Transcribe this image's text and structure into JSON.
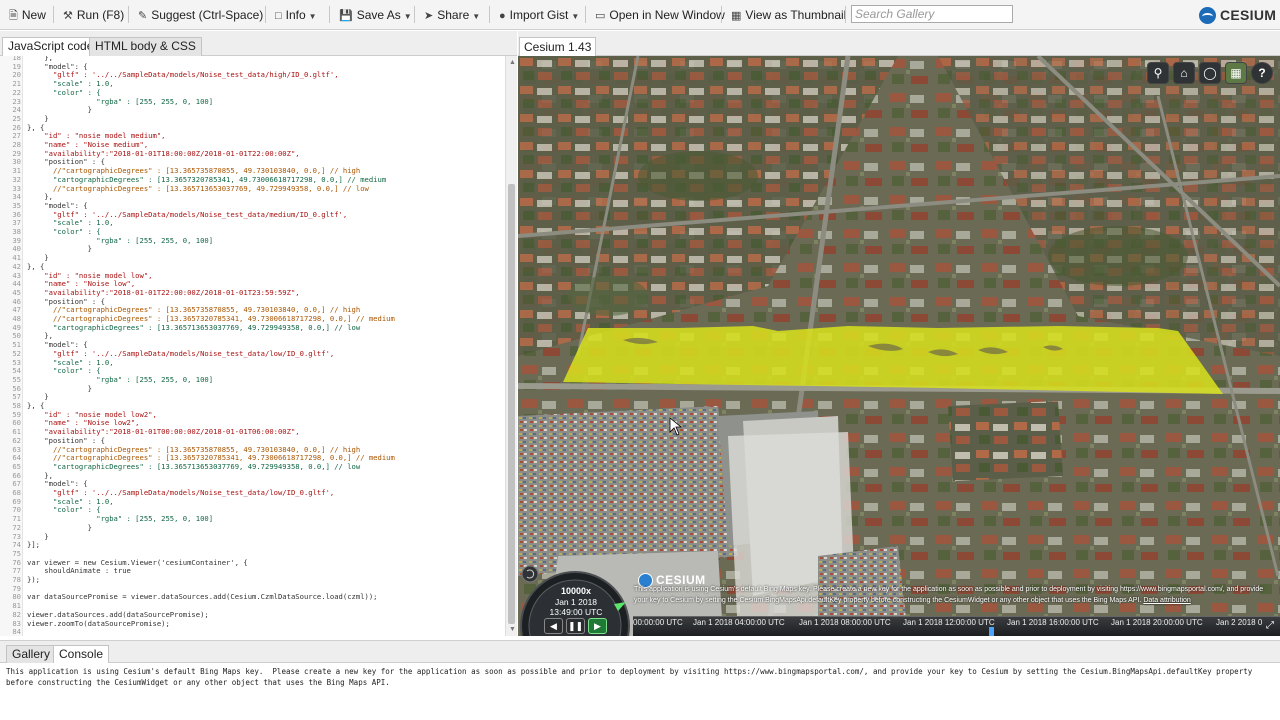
{
  "toolbar": {
    "new_label": "New",
    "run_label": "Run (F8)",
    "suggest_label": "Suggest (Ctrl-Space)",
    "info_label": "Info",
    "save_as_label": "Save As",
    "share_label": "Share",
    "import_gist_label": "Import Gist",
    "open_window_label": "Open in New Window",
    "thumbnail_label": "View as Thumbnail",
    "search_placeholder": "Search Gallery",
    "brand": "CESIUM"
  },
  "editor": {
    "tabs": [
      "JavaScript code",
      "HTML body & CSS"
    ],
    "active_tab": "JavaScript code",
    "first_line_number": 18,
    "lines": [
      "    },",
      "    \"model\": {",
      "      \"gltf\" : '../../SampleData/models/Noise_test_data/high/ID_0.gltf',",
      "      \"scale\" : 1.0,",
      "      \"color\" : {",
      "                \"rgba\" : [255, 255, 0, 100]",
      "              }",
      "    }",
      "}, {",
      "    \"id\" : \"nosie model medium\",",
      "    \"name\" : \"Noise medium\",",
      "    \"availability\":\"2018-01-01T18:00:00Z/2018-01-01T22:00:00Z\",",
      "    \"position\" : {",
      "      //\"cartographicDegrees\" : [13.365735870855, 49.730103840, 0.0,] // high",
      "      \"cartographicDegrees\" : [13.3657320785341, 49.73006618717298, 0.0,] // medium",
      "      //\"cartographicDegrees\" : [13.365713653037769, 49.729949358, 0.0,] // low",
      "    },",
      "    \"model\": {",
      "      \"gltf\" : '../../SampleData/models/Noise_test_data/medium/ID_0.gltf',",
      "      \"scale\" : 1.0,",
      "      \"color\" : {",
      "                \"rgba\" : [255, 255, 0, 100]",
      "              }",
      "    }",
      "}, {",
      "    \"id\" : \"nosie model low\",",
      "    \"name\" : \"Noise low\",",
      "    \"availability\":\"2018-01-01T22:00:00Z/2018-01-01T23:59:59Z\",",
      "    \"position\" : {",
      "      //\"cartographicDegrees\" : [13.365735870855, 49.730103840, 0.0,] // high",
      "      //\"cartographicDegrees\" : [13.3657320785341, 49.73006618717298, 0.0,] // medium",
      "      \"cartographicDegrees\" : [13.365713653037769, 49.729949358, 0.0,] // low",
      "    },",
      "    \"model\": {",
      "      \"gltf\" : '../../SampleData/models/Noise_test_data/low/ID_0.gltf',",
      "      \"scale\" : 1.0,",
      "      \"color\" : {",
      "                \"rgba\" : [255, 255, 0, 100]",
      "              }",
      "    }",
      "}, {",
      "    \"id\" : \"nosie model low2\",",
      "    \"name\" : \"Noise low2\",",
      "    \"availability\":\"2018-01-01T00:00:00Z/2018-01-01T06:00:00Z\",",
      "    \"position\" : {",
      "      //\"cartographicDegrees\" : [13.365735870855, 49.730103840, 0.0,] // high",
      "      //\"cartographicDegrees\" : [13.3657320785341, 49.73006618717298, 0.0,] // medium",
      "      \"cartographicDegrees\" : [13.365713653037769, 49.729949358, 0.0,] // low",
      "    },",
      "    \"model\": {",
      "      \"gltf\" : '../../SampleData/models/Noise_test_data/low/ID_0.gltf',",
      "      \"scale\" : 1.0,",
      "      \"color\" : {",
      "                \"rgba\" : [255, 255, 0, 100]",
      "              }",
      "    }",
      "}];",
      "",
      "var viewer = new Cesium.Viewer('cesiumContainer', {",
      "    shouldAnimate : true",
      "});",
      "",
      "var dataSourcePromise = viewer.dataSources.add(Cesium.CzmlDataSource.load(czml));",
      "",
      "viewer.dataSources.add(dataSourcePromise);",
      "viewer.zoomTo(dataSourcePromise);",
      ""
    ]
  },
  "viewer": {
    "tab_label": "Cesium 1.43",
    "nav_buttons": [
      "search-icon",
      "home-icon",
      "globe-icon",
      "imagery-layer-icon",
      "help-icon"
    ],
    "credit_logo": "CESIUM",
    "credit_text": "This application is using Cesium's default Bing Maps key. Please create a new key for the application as soon as possible and prior to deployment by visiting https://www.bingmapsportal.com/, and provide your key to Cesium by setting the Cesium.BingMapsApi.defaultKey property before constructing the CesiumWidget or any other object that uses the Bing Maps API.",
    "credit_link": "Data attribution",
    "overlay_color": "#d8e21c",
    "animation": {
      "speed": "10000x",
      "date": "Jan 1 2018",
      "time": "13:49:00 UTC",
      "reverse_icon": "play-reverse-icon",
      "pause_icon": "pause-icon",
      "play_icon": "play-icon"
    },
    "timeline_ticks": [
      "00:00:00 UTC",
      "Jan 1 2018 04:00:00 UTC",
      "Jan 1 2018 08:00:00 UTC",
      "Jan 1 2018 12:00:00 UTC",
      "Jan 1 2018 16:00:00 UTC",
      "Jan 1 2018 20:00:00 UTC",
      "Jan 2 2018 0"
    ]
  },
  "bottom": {
    "tabs": [
      "Gallery",
      "Console"
    ],
    "active_tab": "Console",
    "console_message": "This application is using Cesium's default Bing Maps key.  Please create a new key for the application as soon as possible and prior to deployment by visiting https://www.bingmapsportal.com/, and provide your key to Cesium by setting the Cesium.BingMapsApi.defaultKey property before constructing the CesiumWidget or any other object that uses the Bing Maps API."
  }
}
